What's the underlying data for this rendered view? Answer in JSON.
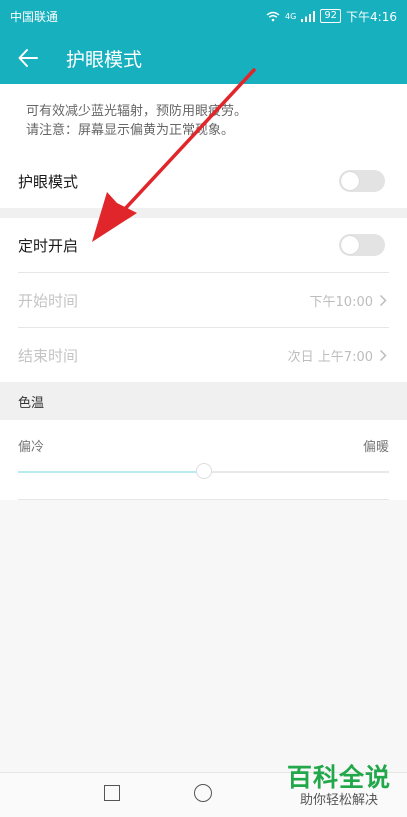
{
  "status_bar": {
    "carrier": "中国联通",
    "network": "4G",
    "battery": "92",
    "time": "下午4:16"
  },
  "app_bar": {
    "title": "护眼模式"
  },
  "description": {
    "line1": "可有效减少蓝光辐射，预防用眼疲劳。",
    "line2": "请注意：屏幕显示偏黄为正常现象。"
  },
  "settings": {
    "eye_comfort": {
      "label": "护眼模式",
      "enabled": false
    },
    "scheduled": {
      "label": "定时开启",
      "enabled": false
    },
    "start_time": {
      "label": "开始时间",
      "value": "下午10:00"
    },
    "end_time": {
      "label": "结束时间",
      "value": "次日 上午7:00"
    }
  },
  "color_temperature": {
    "header": "色温",
    "cool_label": "偏冷",
    "warm_label": "偏暖",
    "level_percent": 50
  },
  "watermark": {
    "main": "百科全说",
    "sub": "助你轻松解决"
  },
  "colors": {
    "accent": "#17b0bf",
    "annotation_arrow": "#e0262a",
    "watermark_green": "#22a84a"
  },
  "icons": {
    "back": "arrow-left-icon",
    "chevron": "chevron-right-icon",
    "nav_recent": "square-icon",
    "nav_home": "circle-icon"
  }
}
